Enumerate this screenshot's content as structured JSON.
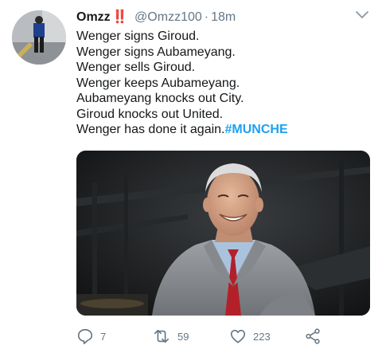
{
  "tweet": {
    "author_name": "Omzz",
    "author_emoji": "‼️",
    "handle": "@Omzz100",
    "separator": "·",
    "time": "18m",
    "lines": [
      "Wenger signs Giroud.",
      "Wenger signs Aubameyang.",
      "Wenger sells Giroud.",
      "Wenger keeps Aubameyang.",
      "Aubameyang knocks out City.",
      "Giroud knocks out United.",
      "Wenger has done it again."
    ],
    "hashtag": "#MUNCHE"
  },
  "actions": {
    "replies": "7",
    "retweets": "59",
    "likes": "223"
  },
  "colors": {
    "link": "#1da1f2",
    "muted": "#657786",
    "text": "#14171a"
  },
  "icons": [
    "chevron-down-icon",
    "reply-icon",
    "retweet-icon",
    "like-icon",
    "share-icon"
  ]
}
